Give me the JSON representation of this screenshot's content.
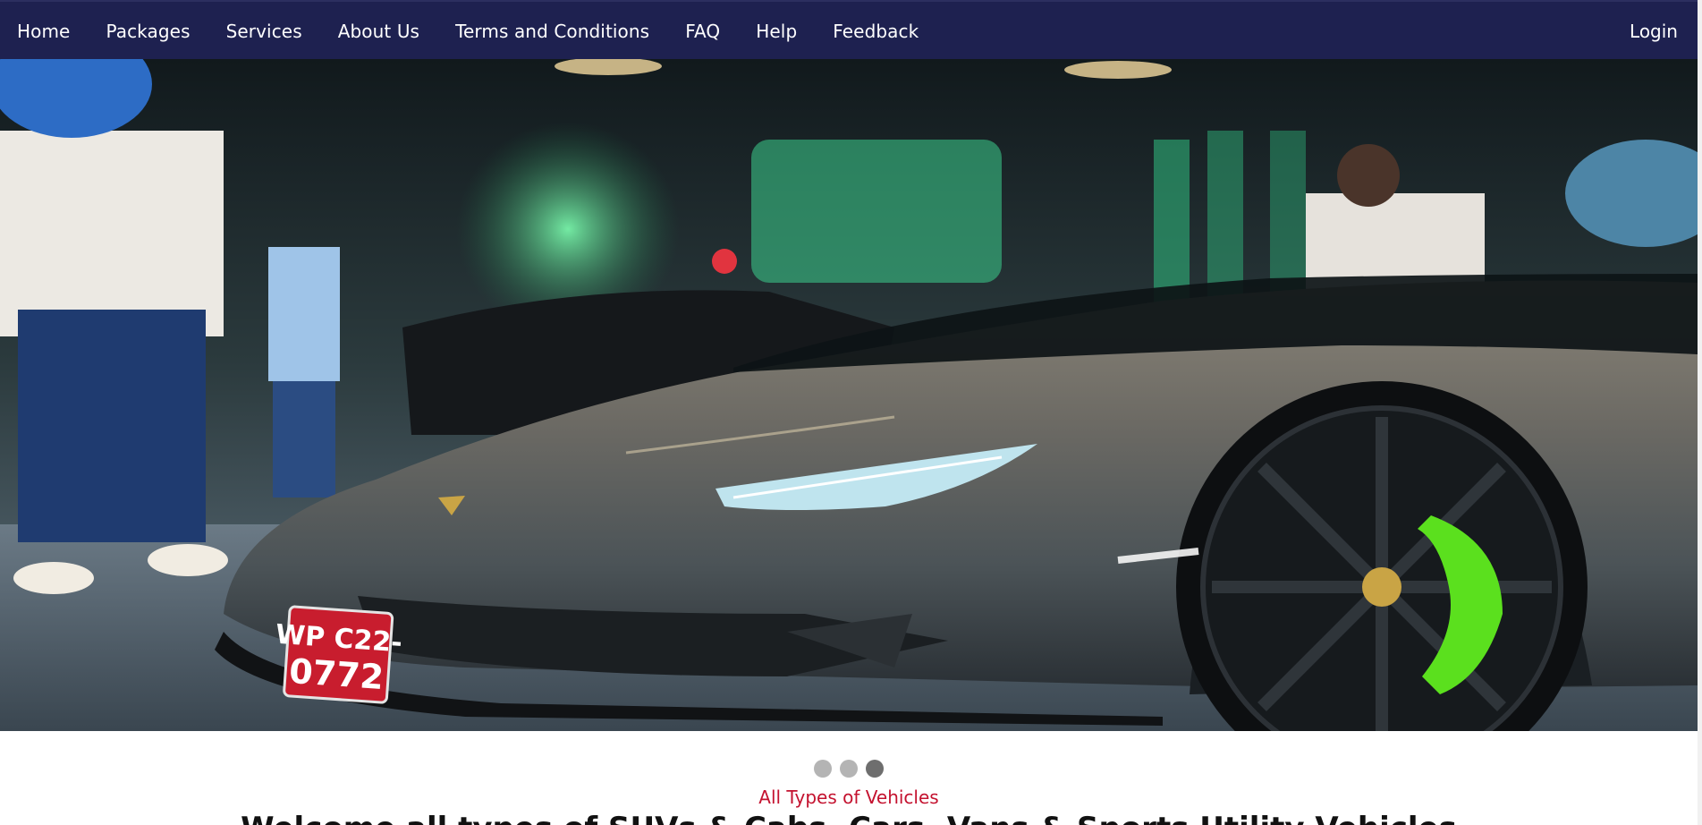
{
  "nav": {
    "links": [
      "Home",
      "Packages",
      "Services",
      "About Us",
      "Terms and Conditions",
      "FAQ",
      "Help",
      "Feedback"
    ],
    "login_label": "Login"
  },
  "hero": {
    "plate_line1": "WP C22-",
    "plate_line2": "0772"
  },
  "carousel": {
    "slide_count": 3,
    "active_index": 2
  },
  "section": {
    "subtitle": "All Types of Vehicles",
    "headline": "Welcome all types of SUVs & Cabs, Cars, Vans & Sports Utility Vehicles"
  },
  "colors": {
    "nav_bg": "#1e2150",
    "subtitle": "#c4122f",
    "dot_active": "#6e6e6e",
    "dot_inactive": "#b4b4b4"
  }
}
